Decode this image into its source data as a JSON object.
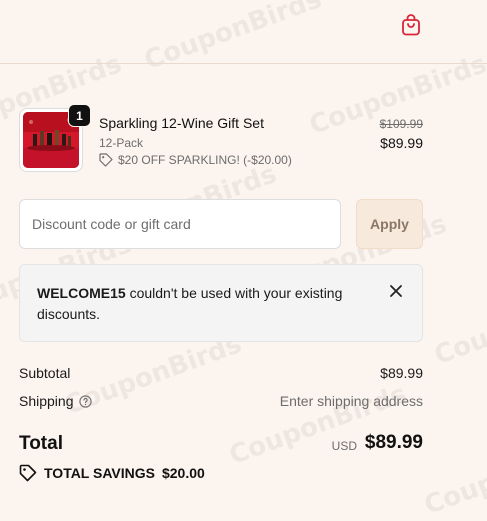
{
  "header": {
    "cart_icon": "shopping-bag-icon"
  },
  "cart_item": {
    "quantity": "1",
    "name": "Sparkling 12-Wine Gift Set",
    "variant": "12-Pack",
    "discount_label": "$20 OFF SPARKLING! (-$20.00)",
    "original_price": "$109.99",
    "price": "$89.99"
  },
  "discount": {
    "placeholder": "Discount code or gift card",
    "apply_label": "Apply"
  },
  "notice": {
    "code": "WELCOME15",
    "message": " couldn't be used with your existing discounts."
  },
  "summary": {
    "subtotal_label": "Subtotal",
    "subtotal_value": "$89.99",
    "shipping_label": "Shipping",
    "shipping_value": "Enter shipping address",
    "total_label": "Total",
    "currency": "USD",
    "total_value": "$89.99",
    "savings_label": "TOTAL SAVINGS",
    "savings_value": "$20.00"
  },
  "watermark": "CouponBirds",
  "colors": {
    "accent": "#d9263a",
    "background": "#fcf4ee",
    "apply_bg": "#f7e9dc"
  }
}
